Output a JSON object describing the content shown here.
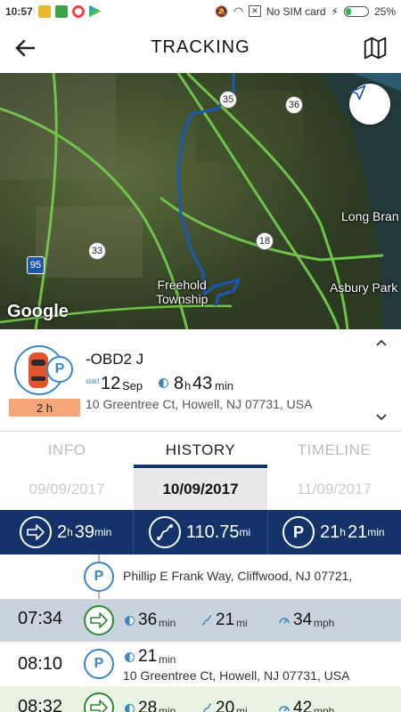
{
  "status_bar": {
    "time": "10:57",
    "carrier": "No SIM card",
    "battery": "25%",
    "battery_level": 0.25
  },
  "app_bar": {
    "title": "TRACKING"
  },
  "map": {
    "labels": {
      "freehold": "Freehold\nTownship",
      "freehold_line1": "Freehold",
      "freehold_line2": "Township",
      "long_branch": "Long Bran",
      "asbury": "Asbury Park"
    },
    "shields": {
      "r35": "35",
      "r36": "36",
      "r33": "33",
      "r18": "18",
      "i95": "95"
    },
    "attribution": "Google"
  },
  "vehicle": {
    "name": "-OBD2 J",
    "park_symbol": "P",
    "duration_badge": "2 h",
    "start_label": "start",
    "start_day": "12",
    "start_month": "Sep",
    "parked_hours": "8",
    "hours_unit": "h",
    "parked_minutes": "43",
    "minutes_unit": "min",
    "address": "10 Greentree Ct, Howell, NJ 07731, USA"
  },
  "tabs": [
    {
      "label": "INFO"
    },
    {
      "label": "HISTORY"
    },
    {
      "label": "TIMELINE"
    }
  ],
  "dates": {
    "prev": "09/09/2017",
    "current": "10/09/2017",
    "next": "11/09/2017"
  },
  "summary": {
    "drive_hours": "2",
    "drive_hours_unit": "h",
    "drive_minutes": "39",
    "drive_minutes_unit": "min",
    "distance": "110.75",
    "distance_unit": "mi",
    "park_symbol": "P",
    "park_hours": "21",
    "park_hours_unit": "h",
    "park_minutes": "21",
    "park_minutes_unit": "min"
  },
  "timeline": {
    "row0": {
      "address": "Phillip E Frank Way, Cliffwood, NJ 07721,",
      "symbol": "P"
    },
    "row1": {
      "time": "07:34",
      "duration": "36",
      "duration_unit": "min",
      "distance": "21",
      "distance_unit": "mi",
      "speed": "34",
      "speed_unit": "mph"
    },
    "row2": {
      "time": "08:10",
      "symbol": "P",
      "duration": "21",
      "duration_unit": "min",
      "address": "10 Greentree Ct, Howell, NJ 07731, USA"
    },
    "row3": {
      "time": "08:32",
      "duration": "28",
      "duration_unit": "min",
      "distance": "20",
      "distance_unit": "mi",
      "speed": "42",
      "speed_unit": "mph"
    }
  },
  "colors": {
    "navy": "#14336b",
    "accent_blue": "#3a86c8",
    "drive_green": "#2f8a2f",
    "badge_orange": "#f5a77a",
    "drive_row_bg": "#c9d3dd",
    "drive_row_bg2": "#e8f3e2"
  }
}
